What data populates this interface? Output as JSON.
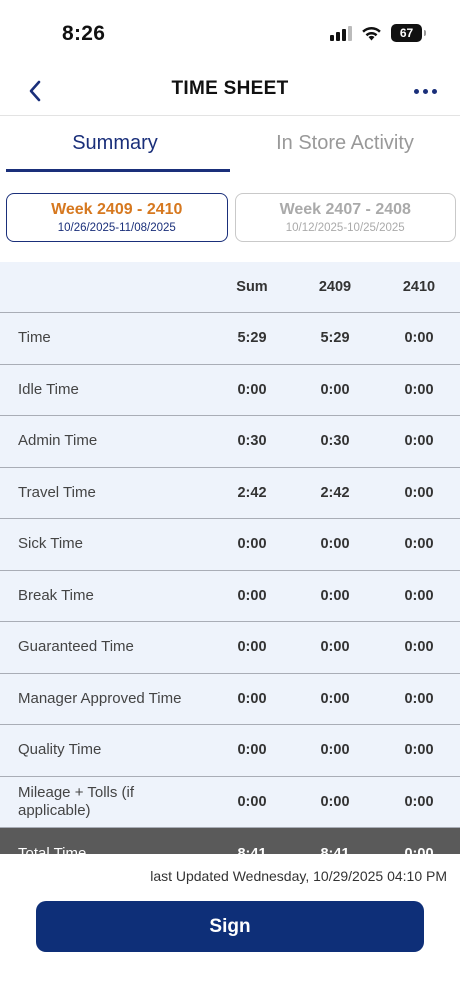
{
  "status_bar": {
    "time": "8:26",
    "battery": "67"
  },
  "nav": {
    "title": "TIME SHEET"
  },
  "tabs": [
    {
      "label": "Summary",
      "active": true
    },
    {
      "label": "In Store Activity",
      "active": false
    }
  ],
  "weeks": [
    {
      "title": "Week 2409 - 2410",
      "dates": "10/26/2025-11/08/2025",
      "active": true
    },
    {
      "title": "Week 2407 - 2408",
      "dates": "10/12/2025-10/25/2025",
      "active": false
    }
  ],
  "table": {
    "columns": [
      "Sum",
      "2409",
      "2410"
    ],
    "rows": [
      {
        "label": "Time",
        "values": [
          "5:29",
          "5:29",
          "0:00"
        ]
      },
      {
        "label": "Idle Time",
        "values": [
          "0:00",
          "0:00",
          "0:00"
        ]
      },
      {
        "label": "Admin Time",
        "values": [
          "0:30",
          "0:30",
          "0:00"
        ]
      },
      {
        "label": "Travel Time",
        "values": [
          "2:42",
          "2:42",
          "0:00"
        ]
      },
      {
        "label": "Sick Time",
        "values": [
          "0:00",
          "0:00",
          "0:00"
        ]
      },
      {
        "label": "Break Time",
        "values": [
          "0:00",
          "0:00",
          "0:00"
        ]
      },
      {
        "label": "Guaranteed Time",
        "values": [
          "0:00",
          "0:00",
          "0:00"
        ]
      },
      {
        "label": "Manager Approved Time",
        "values": [
          "0:00",
          "0:00",
          "0:00"
        ]
      },
      {
        "label": "Quality Time",
        "values": [
          "0:00",
          "0:00",
          "0:00"
        ]
      },
      {
        "label": "Mileage + Tolls (if applicable)",
        "values": [
          "0:00",
          "0:00",
          "0:00"
        ]
      }
    ],
    "total": {
      "label": "Total Time",
      "values": [
        "8:41",
        "8:41",
        "0:00"
      ]
    }
  },
  "footer": {
    "last_updated": "last Updated Wednesday, 10/29/2025 04:10 PM",
    "sign_label": "Sign"
  },
  "colors": {
    "primary": "#1a2f7a",
    "sign_button": "#0e2f78",
    "active_week": "#d6781f",
    "table_bg": "#eef3fb",
    "total_row_bg": "#5a5a5a"
  },
  "icons": {
    "back": "chevron-left-icon",
    "more": "more-horizontal-icon",
    "signal": "cellular-signal-icon",
    "wifi": "wifi-icon",
    "battery": "battery-icon"
  }
}
